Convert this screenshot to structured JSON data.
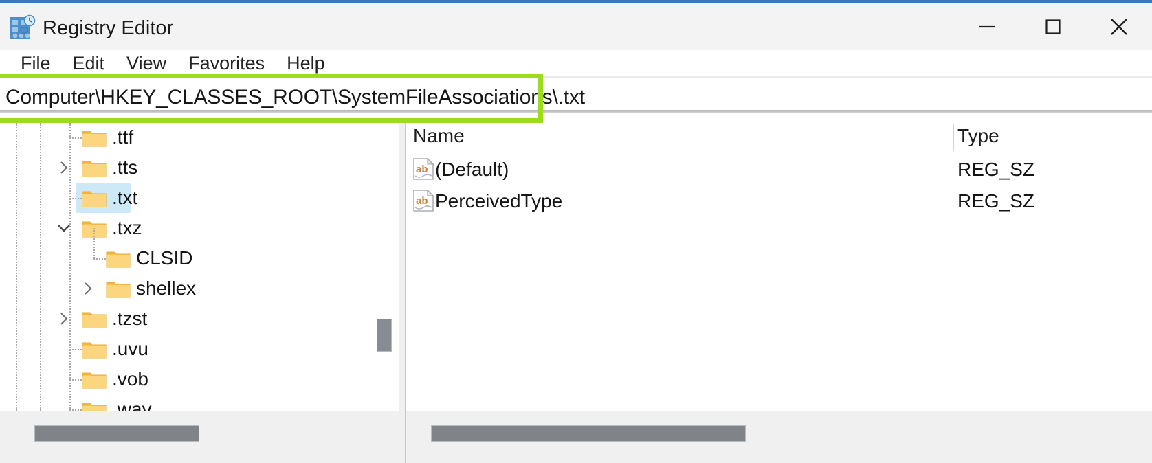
{
  "window": {
    "title": "Registry Editor",
    "icon": "registry-editor-icon",
    "controls": {
      "minimize": "minimize-icon",
      "maximize": "maximize-icon",
      "close": "close-icon"
    },
    "accent_color": "#3878b4"
  },
  "menubar": {
    "items": [
      {
        "label": "File"
      },
      {
        "label": "Edit"
      },
      {
        "label": "View"
      },
      {
        "label": "Favorites"
      },
      {
        "label": "Help"
      }
    ]
  },
  "address_bar": {
    "value": "Computer\\HKEY_CLASSES_ROOT\\SystemFileAssociations\\.txt",
    "placeholder": "Computer\\",
    "highlight_color": "#9ddb1e"
  },
  "tree": {
    "selected_key": ".txt",
    "selection_color": "#cde8f7",
    "items": [
      {
        "label": ".ttf",
        "depth": 3,
        "expander": "none",
        "has_dotted_connector": true
      },
      {
        "label": ".tts",
        "depth": 3,
        "expander": "collapsed",
        "has_dotted_connector": false
      },
      {
        "label": ".txt",
        "depth": 3,
        "expander": "none",
        "has_dotted_connector": true,
        "selected": true
      },
      {
        "label": ".txz",
        "depth": 3,
        "expander": "expanded",
        "has_dotted_connector": false
      },
      {
        "label": "CLSID",
        "depth": 4,
        "expander": "none",
        "has_dotted_connector": true
      },
      {
        "label": "shellex",
        "depth": 4,
        "expander": "collapsed",
        "has_dotted_connector": false
      },
      {
        "label": ".tzst",
        "depth": 3,
        "expander": "collapsed",
        "has_dotted_connector": false
      },
      {
        "label": ".uvu",
        "depth": 3,
        "expander": "none",
        "has_dotted_connector": true
      },
      {
        "label": ".vob",
        "depth": 3,
        "expander": "none",
        "has_dotted_connector": true
      },
      {
        "label": ".wav",
        "depth": 3,
        "expander": "none",
        "has_dotted_connector": true
      }
    ]
  },
  "values_list": {
    "columns": [
      "Name",
      "Type"
    ],
    "rows": [
      {
        "icon": "string-value-icon",
        "name": "(Default)",
        "type": "REG_SZ"
      },
      {
        "icon": "string-value-icon",
        "name": "PerceivedType",
        "type": "REG_SZ"
      }
    ]
  }
}
